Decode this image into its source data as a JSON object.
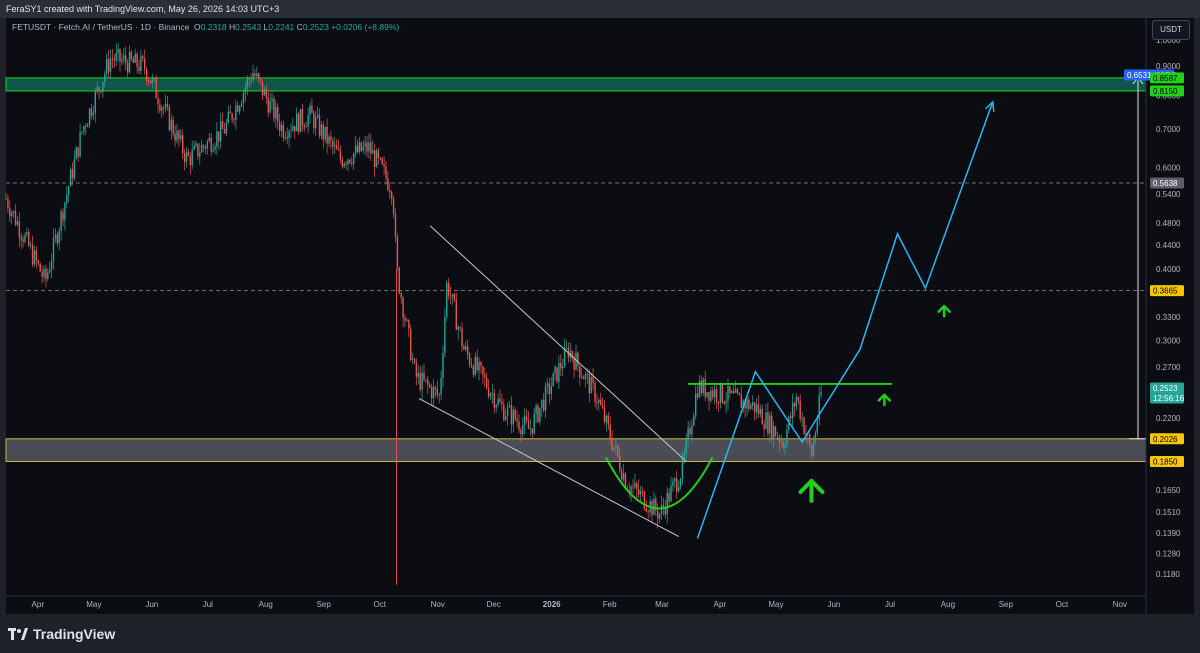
{
  "header": {
    "credit": "FeraSY1 created with TradingView.com, May 26, 2026 14:03 UTC+3"
  },
  "symbol": {
    "name": "FETUSDT · Fetch.AI / TetherUS · 1D · Binance",
    "open_label": "O",
    "open": "0.2318",
    "high_label": "H",
    "high": "0.2543",
    "low_label": "L",
    "low": "0.2241",
    "close_label": "C",
    "close": "0.2523",
    "change": "+0.0206 (+8.89%)"
  },
  "currency_button": "USDT",
  "branding": {
    "name": "TradingView"
  },
  "colors": {
    "up": "#26a69a",
    "down": "#ef5350",
    "accent_green": "#22d01b",
    "path_blue": "#29b6f6",
    "yellow": "#c9b33a"
  },
  "chart_data": {
    "type": "candlestick",
    "y_scale": "log",
    "ylim": [
      0.108,
      1.04
    ],
    "y_ticks": [
      "1.0000",
      "0.9000",
      "0.8000",
      "0.7000",
      "0.6000",
      "0.5400",
      "0.4800",
      "0.4400",
      "0.4000",
      "0.3300",
      "0.3000",
      "0.2700",
      "0.2200",
      "0.1850",
      "0.1650",
      "0.1510",
      "0.1390",
      "0.1280",
      "0.1180"
    ],
    "x_ticks": [
      "Apr",
      "May",
      "Jun",
      "Jul",
      "Aug",
      "Sep",
      "Oct",
      "Nov",
      "Dec",
      "2026",
      "Feb",
      "Mar",
      "Apr",
      "May",
      "Jun",
      "Jul",
      "Aug",
      "Sep",
      "Oct",
      "Nov"
    ],
    "price_markers": [
      {
        "label": "0.6531 (337.6",
        "color": "#2962ff"
      },
      {
        "label": "0.8587",
        "color": "#22d01b"
      },
      {
        "label": "0.8150",
        "color": "#22d01b"
      },
      {
        "label": "0.5638",
        "color": "#5d606b"
      },
      {
        "label": "0.3665",
        "color": "#f7c600"
      },
      {
        "label": "0.2523",
        "color": "#26a69a"
      },
      {
        "label": "12:56:16",
        "color": "#26a69a"
      },
      {
        "label": "0.2026",
        "color": "#f7c600"
      },
      {
        "label": "0.1850",
        "color": "#f7c600"
      }
    ],
    "levels": {
      "resistance_zone": [
        0.815,
        0.8587
      ],
      "dashed": [
        0.5638,
        0.3665
      ],
      "support_zone": [
        0.185,
        0.2026
      ],
      "neckline": 0.2523,
      "measured_move": [
        0.2026,
        0.8587
      ]
    },
    "price_path": [
      [
        "2025-03-15",
        0.53
      ],
      [
        "2025-04-05",
        0.38
      ],
      [
        "2025-04-25",
        0.7
      ],
      [
        "2025-05-10",
        0.93
      ],
      [
        "2025-05-28",
        0.9
      ],
      [
        "2025-06-20",
        0.62
      ],
      [
        "2025-07-10",
        0.7
      ],
      [
        "2025-07-25",
        0.88
      ],
      [
        "2025-08-10",
        0.7
      ],
      [
        "2025-08-25",
        0.74
      ],
      [
        "2025-09-10",
        0.62
      ],
      [
        "2025-09-25",
        0.65
      ],
      [
        "2025-10-08",
        0.55
      ],
      [
        "2025-10-10",
        0.4
      ],
      [
        "2025-10-20",
        0.26
      ],
      [
        "2025-11-02",
        0.24
      ],
      [
        "2025-11-06",
        0.38
      ],
      [
        "2025-11-15",
        0.29
      ],
      [
        "2025-12-05",
        0.23
      ],
      [
        "2025-12-20",
        0.21
      ],
      [
        "2026-01-10",
        0.29
      ],
      [
        "2026-01-25",
        0.24
      ],
      [
        "2026-02-10",
        0.17
      ],
      [
        "2026-02-28",
        0.15
      ],
      [
        "2026-03-12",
        0.18
      ],
      [
        "2026-03-20",
        0.25
      ],
      [
        "2026-04-05",
        0.24
      ],
      [
        "2026-04-20",
        0.23
      ],
      [
        "2026-05-05",
        0.2
      ],
      [
        "2026-05-12",
        0.24
      ],
      [
        "2026-05-20",
        0.19
      ],
      [
        "2026-05-26",
        0.2523
      ]
    ],
    "projection": [
      [
        "2026-03-20",
        0.136
      ],
      [
        "2026-04-20",
        0.265
      ],
      [
        "2026-05-15",
        0.2
      ],
      [
        "2026-06-15",
        0.29
      ],
      [
        "2026-07-05",
        0.46
      ],
      [
        "2026-07-20",
        0.37
      ],
      [
        "2026-08-25",
        0.78
      ]
    ]
  }
}
